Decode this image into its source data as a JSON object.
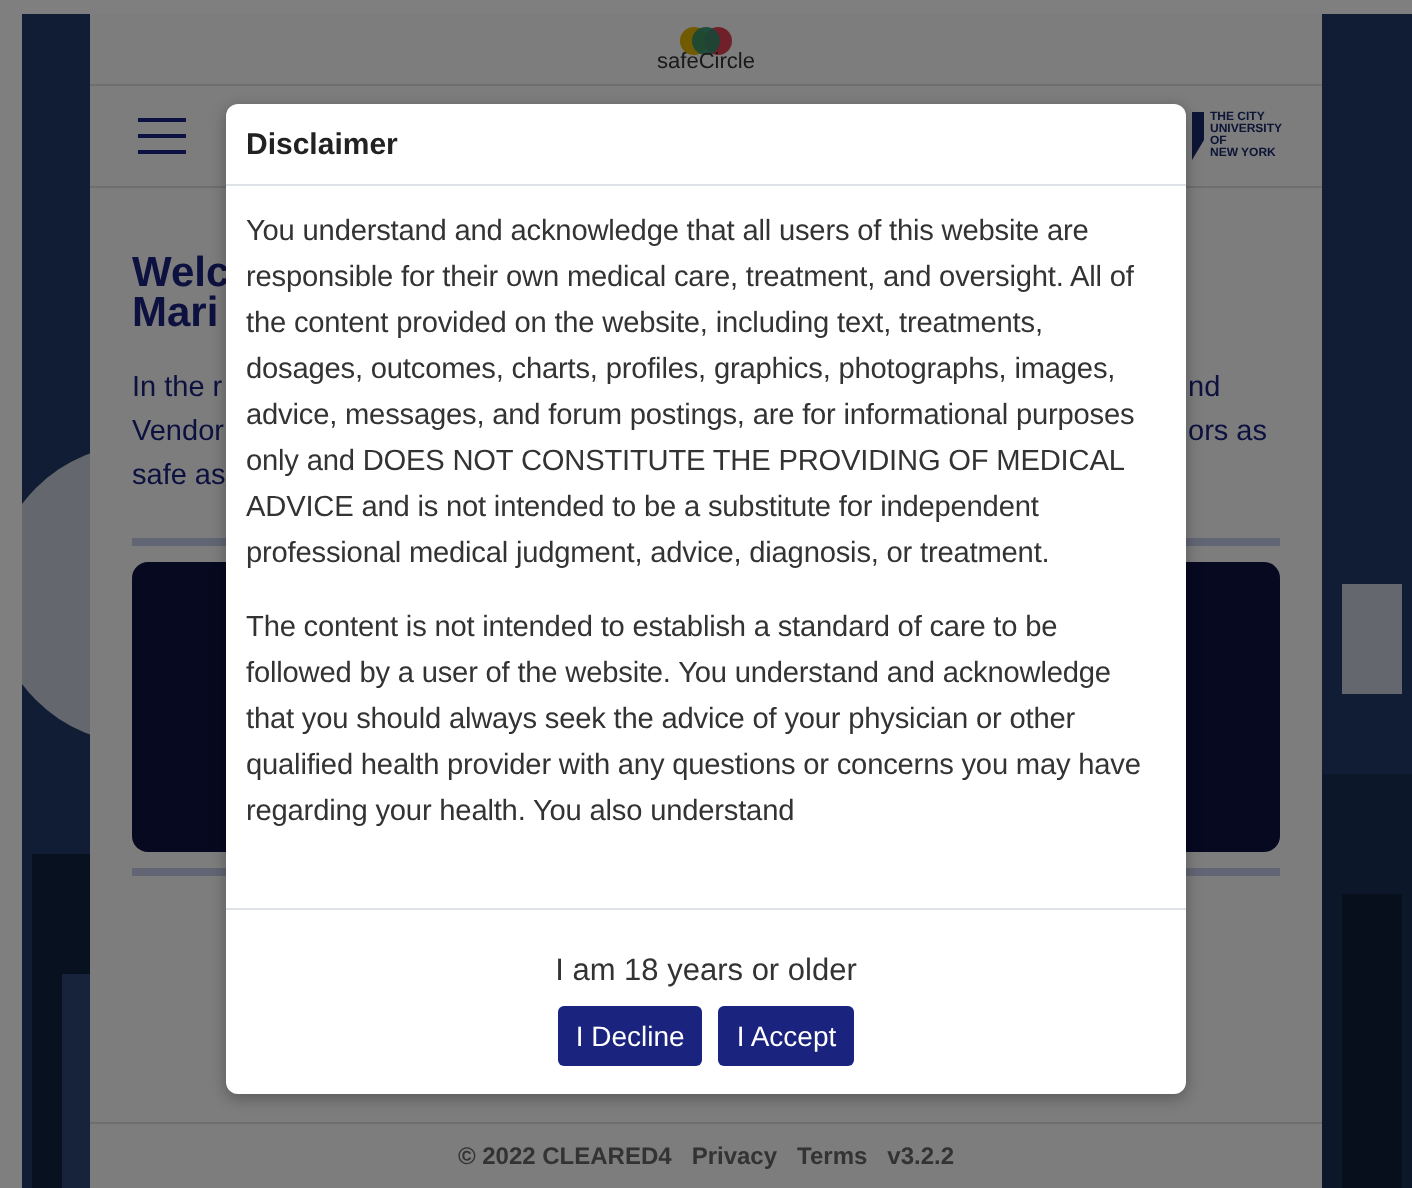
{
  "header": {
    "brand": "safeCircle",
    "partner_logo_lines": [
      "THE CITY",
      "UNIVERSITY",
      "OF",
      "NEW YORK"
    ]
  },
  "page": {
    "heading_left": [
      "Welc",
      "Mari"
    ],
    "intro_left": [
      "In the r",
      "Vendor",
      "safe as"
    ],
    "intro_right": [
      "nd",
      "ors as"
    ]
  },
  "footer": {
    "copyright": "© 2022 CLEARED4",
    "links": [
      "Privacy",
      "Terms"
    ],
    "version": "v3.2.2"
  },
  "modal": {
    "title": "Disclaimer",
    "paragraphs": [
      "You understand and acknowledge that all users of this website are responsible for their own medical care, treatment, and oversight. All of the content provided on the website, including text, treatments, dosages, outcomes, charts, profiles, graphics, photographs, images, advice, messages, and forum postings, are for informational purposes only and DOES NOT CONSTITUTE THE PROVIDING OF MEDICAL ADVICE and is not intended to be a substitute for independent professional medical judgment, advice, diagnosis, or treatment.",
      "The content is not intended to establish a standard of care to be followed by a user of the website. You understand and acknowledge that you should always seek the advice of your physician or other qualified health provider with any questions or concerns you may have regarding your health. You also understand"
    ],
    "age_statement": "I am 18 years or older",
    "buttons": [
      "I Decline",
      "I Accept"
    ]
  }
}
